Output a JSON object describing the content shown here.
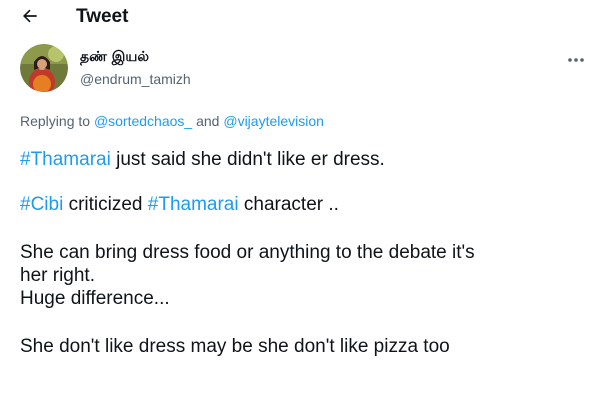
{
  "header": {
    "title": "Tweet"
  },
  "author": {
    "display_name": "தண் இயல்",
    "username": "@endrum_tamizh"
  },
  "reply": {
    "prefix": "Replying to ",
    "mention1": "@sortedchaos_",
    "conjunction": " and ",
    "mention2": "@vijaytelevision"
  },
  "tweet": {
    "p1": {
      "hashtag": "#Thamarai",
      "text": " just said she didn't like er dress."
    },
    "p2": {
      "hashtag1": "#Cibi",
      "text1": " criticized ",
      "hashtag2": "#Thamarai",
      "text2": " character .."
    },
    "p3": {
      "line1": "She can bring dress food or anything to the debate it's",
      "line2": "her right.",
      "line3": "Huge difference..."
    },
    "p4": {
      "line1": "She don't like dress may be she don't like pizza too"
    }
  },
  "colors": {
    "accent": "#1d9bf0",
    "text": "#0f1419",
    "secondary": "#536471"
  },
  "icons": {
    "back": "arrow-left-icon",
    "more": "more-horizontal-icon"
  }
}
